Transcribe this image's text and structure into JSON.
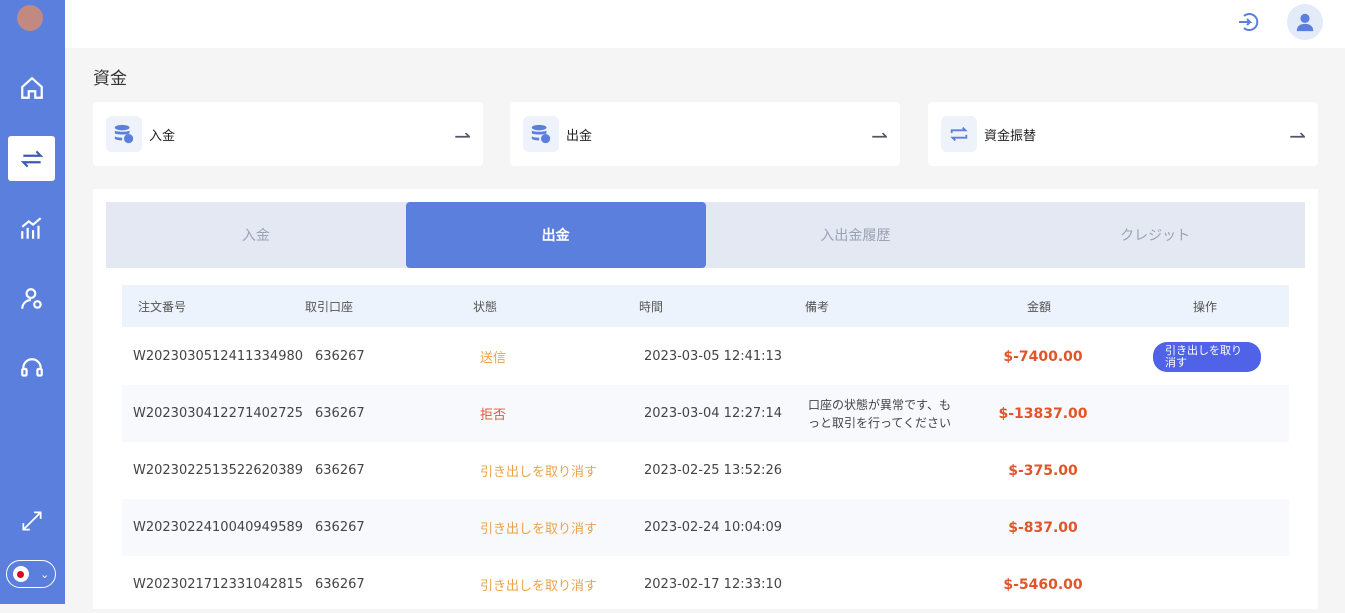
{
  "page_title": "資金",
  "cards": [
    {
      "label": "入金",
      "icon": "database-plus-icon"
    },
    {
      "label": "出金",
      "icon": "database-minus-icon"
    },
    {
      "label": "資金振替",
      "icon": "transfer-icon"
    }
  ],
  "tabs": [
    "入金",
    "出金",
    "入出金履歴",
    "クレジット"
  ],
  "active_tab": "出金",
  "table": {
    "headers": [
      "注文番号",
      "取引口座",
      "状態",
      "時間",
      "備考",
      "金額",
      "操作"
    ],
    "rows": [
      {
        "order": "W2023030512411334980",
        "account": "636267",
        "status": "送信",
        "time": "2023-03-05 12:41:13",
        "note": "",
        "amount": "$-7400.00",
        "action": "引き出しを取り消す"
      },
      {
        "order": "W2023030412271402725",
        "account": "636267",
        "status": "拒否",
        "time": "2023-03-04 12:27:14",
        "note": "口座の状態が異常です、もっと取引を行ってください",
        "amount": "$-13837.00",
        "action": ""
      },
      {
        "order": "W2023022513522620389",
        "account": "636267",
        "status": "引き出しを取り消す",
        "time": "2023-02-25 13:52:26",
        "note": "",
        "amount": "$-375.00",
        "action": ""
      },
      {
        "order": "W2023022410040949589",
        "account": "636267",
        "status": "引き出しを取り消す",
        "time": "2023-02-24 10:04:09",
        "note": "",
        "amount": "$-837.00",
        "action": ""
      },
      {
        "order": "W2023021712331042815",
        "account": "636267",
        "status": "引き出しを取り消す",
        "time": "2023-02-17 12:33:10",
        "note": "",
        "amount": "$-5460.00",
        "action": ""
      }
    ]
  },
  "colors": {
    "sidebar": "#5b7fdc",
    "accent": "#5b7fdc",
    "amount": "#e0552a",
    "button": "#4f62e8"
  }
}
